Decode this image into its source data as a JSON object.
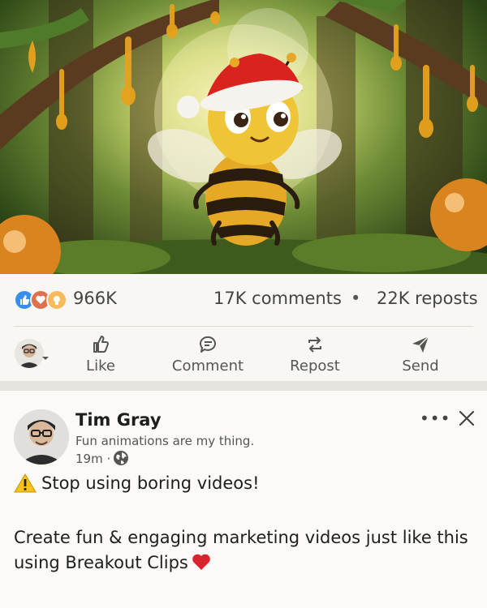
{
  "media": {
    "subject": "animated bee wearing a santa hat"
  },
  "stats": {
    "reaction_icons": [
      "like-icon",
      "love-icon",
      "insightful-icon"
    ],
    "likes": "966K",
    "comments": "17K comments",
    "separator": "•",
    "reposts": "22K reposts"
  },
  "actions": {
    "like": "Like",
    "comment": "Comment",
    "repost": "Repost",
    "send": "Send"
  },
  "post": {
    "author": "Tim Gray",
    "tagline": "Fun animations are my thing.",
    "time": "19m ·",
    "visibility_icon": "globe-icon",
    "more": "•••",
    "line1": "Stop using boring videos!",
    "body": "Create fun & engaging marketing videos just like this using Breakout Clips"
  },
  "colors": {
    "like_blue": "#378fe9",
    "love_orange": "#df704d",
    "insight_yellow": "#f5bb5c",
    "heart_red": "#d9232e"
  }
}
